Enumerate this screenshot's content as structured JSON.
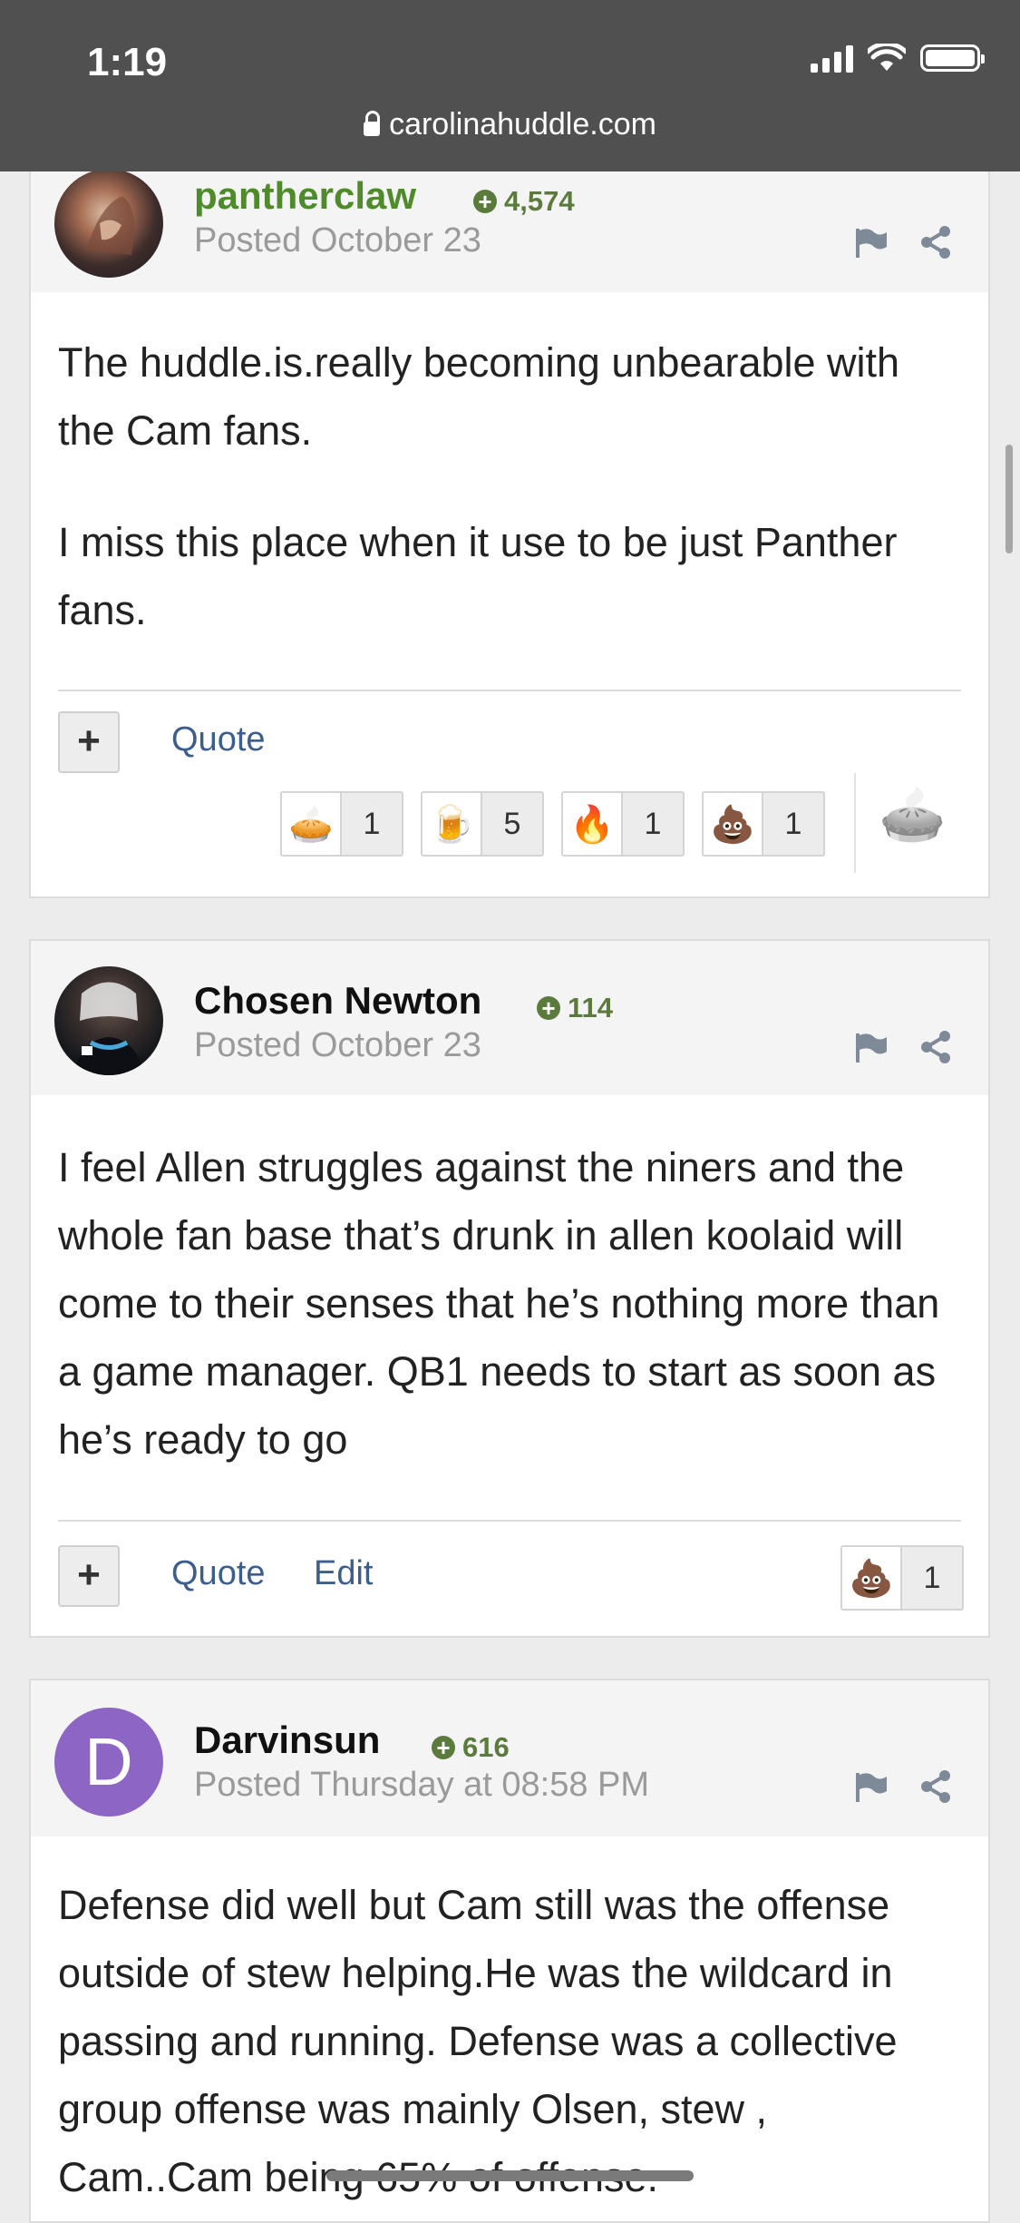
{
  "status_bar": {
    "time": "1:19"
  },
  "browser": {
    "url": "carolinahuddle.com"
  },
  "posts": [
    {
      "author": "pantherclaw",
      "author_color": "#4f8a2b",
      "reputation": "4,574",
      "posted": "Posted October 23",
      "body": [
        "The huddle.is.really becoming unbearable with the Cam fans.",
        "I miss this place when it use to be just Panther fans."
      ],
      "actions": {
        "plus": "+",
        "quote": "Quote"
      },
      "reactions": [
        {
          "icon": "pie-icon",
          "emoji": "🥧",
          "count": "1"
        },
        {
          "icon": "beer-icon",
          "emoji": "🍺",
          "count": "5"
        },
        {
          "icon": "fire-icon",
          "emoji": "🔥",
          "count": "1"
        },
        {
          "icon": "poop-icon",
          "emoji": "💩",
          "count": "1"
        }
      ],
      "react_button_emoji": "🥧"
    },
    {
      "author": "Chosen Newton",
      "author_color": "#111111",
      "reputation": "114",
      "posted": "Posted October 23",
      "body": [
        "I feel Allen struggles against the niners and the whole fan base that’s drunk in allen koolaid will come to their senses that he’s nothing more than a game manager. QB1 needs to start as soon as he’s ready to go"
      ],
      "actions": {
        "plus": "+",
        "quote": "Quote",
        "edit": "Edit"
      },
      "reactions": [
        {
          "icon": "poop-icon",
          "emoji": "💩",
          "count": "1"
        }
      ]
    },
    {
      "author": "Darvinsun",
      "author_color": "#111111",
      "avatar_letter": "D",
      "reputation": "616",
      "posted": "Posted Thursday at 08:58 PM",
      "body": [
        "Defense did well but Cam still was the offense outside of stew helping.He was the wildcard in passing and running. Defense was a collective group  offense was mainly Olsen, stew , Cam..Cam being 65% of offense."
      ]
    }
  ]
}
